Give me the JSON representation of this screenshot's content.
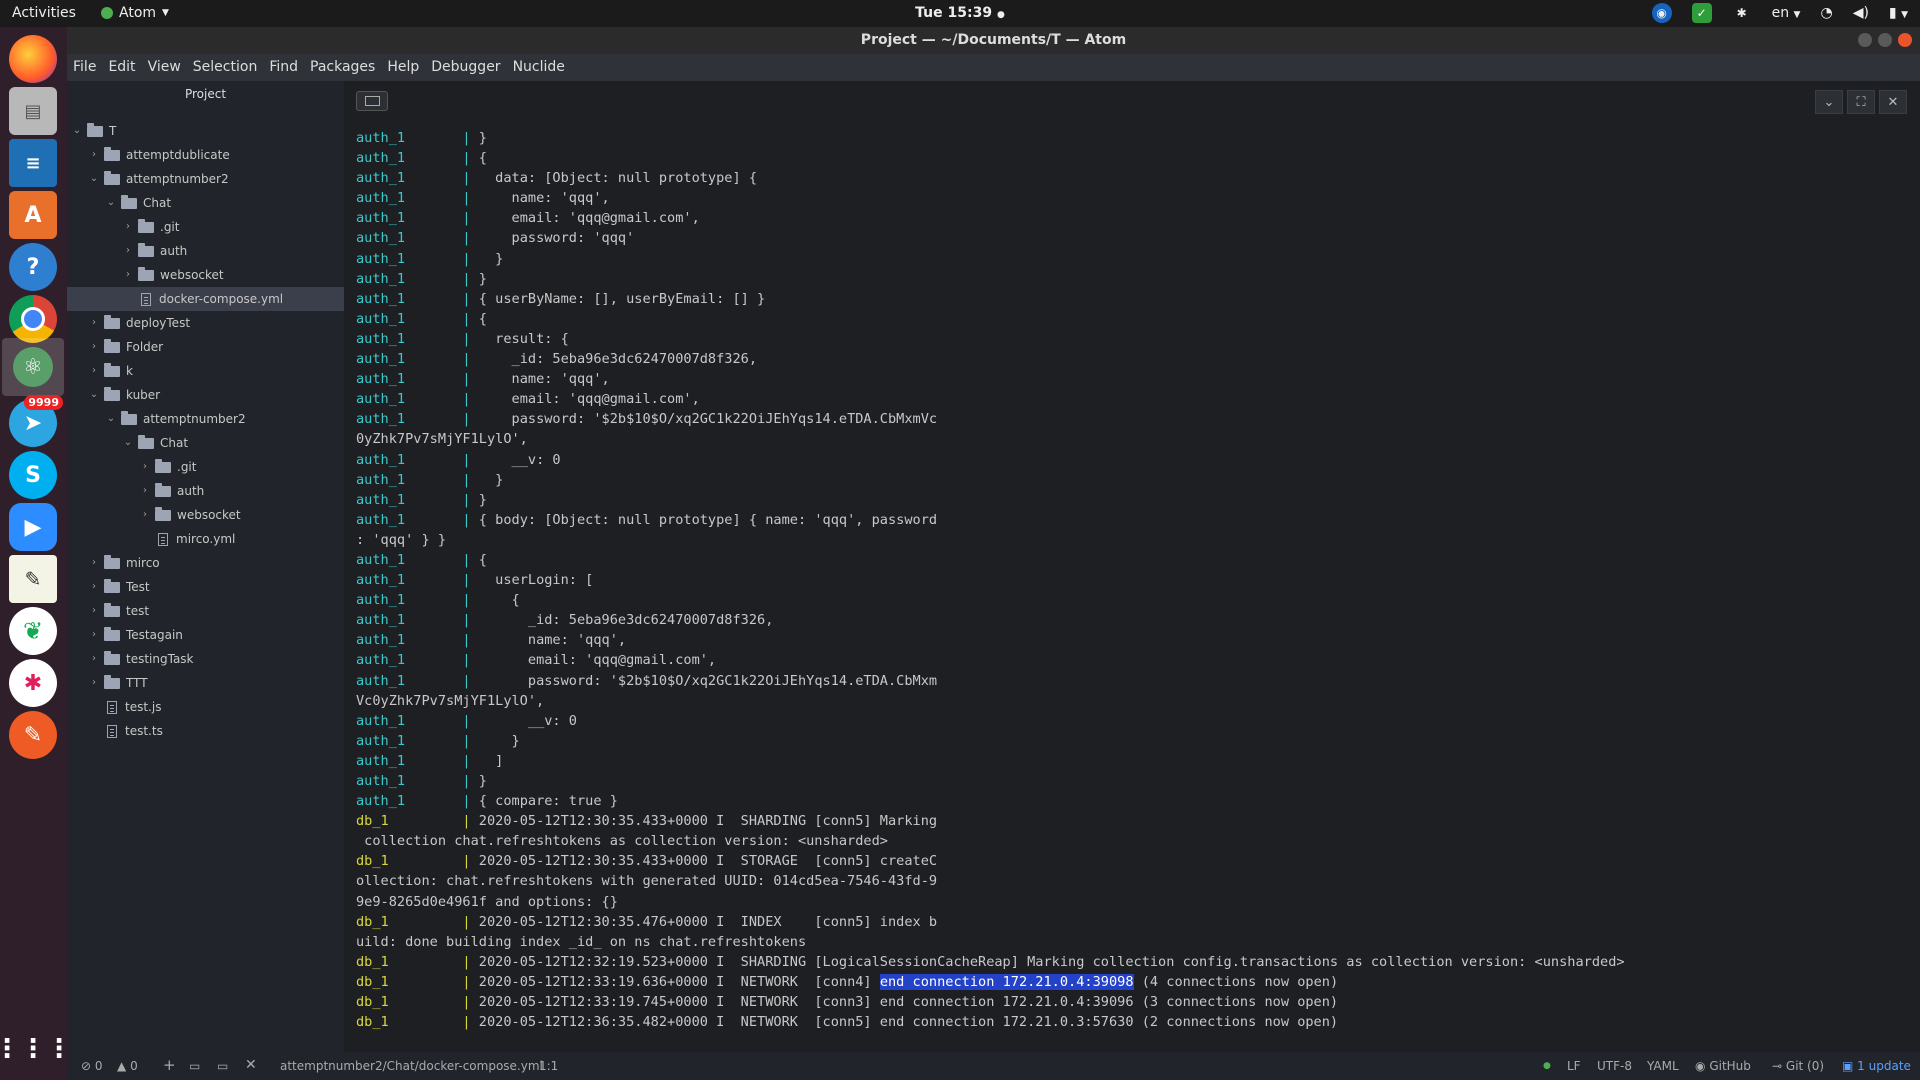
{
  "topbar": {
    "activities": "Activities",
    "app": "Atom",
    "clock": "Tue 15:39",
    "lang": "en"
  },
  "window": {
    "title": "Project — ~/Documents/T — Atom"
  },
  "menu": [
    "File",
    "Edit",
    "View",
    "Selection",
    "Find",
    "Packages",
    "Help",
    "Debugger",
    "Nuclide"
  ],
  "dock": {
    "telegram_badge": "9999"
  },
  "tree": {
    "header": "Project",
    "nodes": [
      {
        "label": "T",
        "depth": 0,
        "type": "folder",
        "open": true
      },
      {
        "label": "attemptdublicate",
        "depth": 1,
        "type": "folder",
        "open": false
      },
      {
        "label": "attemptnumber2",
        "depth": 1,
        "type": "folder",
        "open": true
      },
      {
        "label": "Chat",
        "depth": 2,
        "type": "folder",
        "open": true
      },
      {
        "label": ".git",
        "depth": 3,
        "type": "folder",
        "open": false
      },
      {
        "label": "auth",
        "depth": 3,
        "type": "folder",
        "open": false
      },
      {
        "label": "websocket",
        "depth": 3,
        "type": "folder",
        "open": false
      },
      {
        "label": "docker-compose.yml",
        "depth": 3,
        "type": "file",
        "selected": true
      },
      {
        "label": "deployTest",
        "depth": 1,
        "type": "folder",
        "open": false
      },
      {
        "label": "Folder",
        "depth": 1,
        "type": "folder",
        "open": false
      },
      {
        "label": "k",
        "depth": 1,
        "type": "folder",
        "open": false
      },
      {
        "label": "kuber",
        "depth": 1,
        "type": "folder",
        "open": true
      },
      {
        "label": "attemptnumber2",
        "depth": 2,
        "type": "folder",
        "open": true
      },
      {
        "label": "Chat",
        "depth": 3,
        "type": "folder",
        "open": true
      },
      {
        "label": ".git",
        "depth": 4,
        "type": "folder",
        "open": false
      },
      {
        "label": "auth",
        "depth": 4,
        "type": "folder",
        "open": false
      },
      {
        "label": "websocket",
        "depth": 4,
        "type": "folder",
        "open": false
      },
      {
        "label": "mirco.yml",
        "depth": 4,
        "type": "file"
      },
      {
        "label": "mirco",
        "depth": 1,
        "type": "folder",
        "open": false
      },
      {
        "label": "Test",
        "depth": 1,
        "type": "folder",
        "open": false
      },
      {
        "label": "test",
        "depth": 1,
        "type": "folder",
        "open": false
      },
      {
        "label": "Testagain",
        "depth": 1,
        "type": "folder",
        "open": false
      },
      {
        "label": "testingTask",
        "depth": 1,
        "type": "folder",
        "open": false
      },
      {
        "label": "TTT",
        "depth": 1,
        "type": "folder",
        "open": false
      },
      {
        "label": "test.js",
        "depth": 1,
        "type": "file"
      },
      {
        "label": "test.ts",
        "depth": 1,
        "type": "file"
      }
    ]
  },
  "terminal": {
    "lines": [
      {
        "svc": "auth_1",
        "text": " }"
      },
      {
        "svc": "auth_1",
        "text": " {"
      },
      {
        "svc": "auth_1",
        "text": "   data: [Object: null prototype] {"
      },
      {
        "svc": "auth_1",
        "text": "     name: 'qqq',"
      },
      {
        "svc": "auth_1",
        "text": "     email: 'qqq@gmail.com',"
      },
      {
        "svc": "auth_1",
        "text": "     password: 'qqq'"
      },
      {
        "svc": "auth_1",
        "text": "   }"
      },
      {
        "svc": "auth_1",
        "text": " }"
      },
      {
        "svc": "auth_1",
        "text": " { userByName: [], userByEmail: [] }"
      },
      {
        "svc": "auth_1",
        "text": " {"
      },
      {
        "svc": "auth_1",
        "text": "   result: {"
      },
      {
        "svc": "auth_1",
        "text": "     _id: 5eba96e3dc62470007d8f326,"
      },
      {
        "svc": "auth_1",
        "text": "     name: 'qqq',"
      },
      {
        "svc": "auth_1",
        "text": "     email: 'qqq@gmail.com',"
      },
      {
        "svc": "auth_1",
        "text": "     password: '$2b$10$O/xq2GC1k22OiJEhYqs14.eTDA.CbMxmVc"
      },
      {
        "svc": "",
        "text": "0yZhk7Pv7sMjYF1LylO',"
      },
      {
        "svc": "auth_1",
        "text": "     __v: 0"
      },
      {
        "svc": "auth_1",
        "text": "   }"
      },
      {
        "svc": "auth_1",
        "text": " }"
      },
      {
        "svc": "auth_1",
        "text": " { body: [Object: null prototype] { name: 'qqq', password"
      },
      {
        "svc": "",
        "text": ": 'qqq' } }"
      },
      {
        "svc": "auth_1",
        "text": " {"
      },
      {
        "svc": "auth_1",
        "text": "   userLogin: ["
      },
      {
        "svc": "auth_1",
        "text": "     {"
      },
      {
        "svc": "auth_1",
        "text": "       _id: 5eba96e3dc62470007d8f326,"
      },
      {
        "svc": "auth_1",
        "text": "       name: 'qqq',"
      },
      {
        "svc": "auth_1",
        "text": "       email: 'qqq@gmail.com',"
      },
      {
        "svc": "auth_1",
        "text": "       password: '$2b$10$O/xq2GC1k22OiJEhYqs14.eTDA.CbMxm"
      },
      {
        "svc": "",
        "text": "Vc0yZhk7Pv7sMjYF1LylO',"
      },
      {
        "svc": "auth_1",
        "text": "       __v: 0"
      },
      {
        "svc": "auth_1",
        "text": "     }"
      },
      {
        "svc": "auth_1",
        "text": "   ]"
      },
      {
        "svc": "auth_1",
        "text": " }"
      },
      {
        "svc": "auth_1",
        "text": " { compare: true }"
      },
      {
        "svc": "db_1",
        "text": " 2020-05-12T12:30:35.433+0000 I  SHARDING [conn5] Marking"
      },
      {
        "svc": "",
        "text": " collection chat.refreshtokens as collection version: <unsharded>"
      },
      {
        "svc": "db_1",
        "text": " 2020-05-12T12:30:35.433+0000 I  STORAGE  [conn5] createC"
      },
      {
        "svc": "",
        "text": "ollection: chat.refreshtokens with generated UUID: 014cd5ea-7546-43fd-9"
      },
      {
        "svc": "",
        "text": "9e9-8265d0e4961f and options: {}"
      },
      {
        "svc": "db_1",
        "text": " 2020-05-12T12:30:35.476+0000 I  INDEX    [conn5] index b"
      },
      {
        "svc": "",
        "text": "uild: done building index _id_ on ns chat.refreshtokens"
      },
      {
        "svc": "db_1",
        "text": " 2020-05-12T12:32:19.523+0000 I  SHARDING [LogicalSessionCacheReap] Marking collection config.transactions as collection version: <unsharded>"
      },
      {
        "svc": "db_1",
        "text": " 2020-05-12T12:33:19.636+0000 I  NETWORK  [conn4] ",
        "hl": "end connection 172.21.0.4:39098",
        "after": " (4 connections now open)"
      },
      {
        "svc": "db_1",
        "text": " 2020-05-12T12:33:19.745+0000 I  NETWORK  [conn3] end connection 172.21.0.4:39096 (3 connections now open)"
      },
      {
        "svc": "db_1",
        "text": " 2020-05-12T12:36:35.482+0000 I  NETWORK  [conn5] end connection 172.21.0.3:57630 (2 connections now open)"
      }
    ]
  },
  "statusbar": {
    "errors": "0",
    "warnings": "0",
    "path": "attemptnumber2/Chat/docker-compose.yml",
    "cursor": "1:1",
    "eol": "LF",
    "encoding": "UTF-8",
    "grammar": "YAML",
    "github": "GitHub",
    "git": "Git (0)",
    "update": "1 update"
  }
}
